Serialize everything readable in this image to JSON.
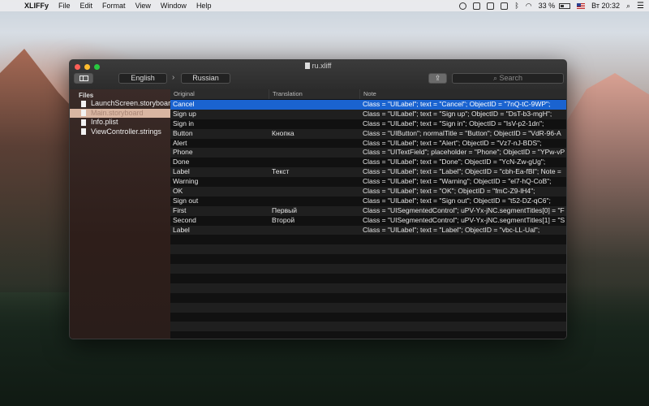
{
  "menubar": {
    "app_name": "XLIFFy",
    "menus": [
      "File",
      "Edit",
      "Format",
      "View",
      "Window",
      "Help"
    ],
    "battery": "33 %",
    "clock": "Вт 20:32"
  },
  "window": {
    "title": "ru.xliff",
    "source_language": "English",
    "target_language": "Russian",
    "search_placeholder": "Search"
  },
  "sidebar": {
    "header": "Files",
    "files": [
      {
        "name": "LaunchScreen.storyboard",
        "selected": false
      },
      {
        "name": "Main.storyboard",
        "selected": true
      },
      {
        "name": "Info.plist",
        "selected": false
      },
      {
        "name": "ViewController.strings",
        "selected": false
      }
    ]
  },
  "table": {
    "columns": [
      "Original",
      "Translation",
      "Note"
    ],
    "rows": [
      {
        "original": "Cancel",
        "translation": "",
        "note": "Class = \"UILabel\"; text = \"Cancel\"; ObjectID = \"7nQ-tC-9WP\";",
        "selected": true
      },
      {
        "original": "Sign up",
        "translation": "",
        "note": "Class = \"UILabel\"; text = \"Sign up\"; ObjectID = \"DsT-b3-mgH\";"
      },
      {
        "original": "Sign in",
        "translation": "",
        "note": "Class = \"UILabel\"; text = \"Sign in\"; ObjectID = \"IsV-p2-1dn\";"
      },
      {
        "original": "Button",
        "translation": "Кнопка",
        "note": "Class = \"UIButton\"; normalTitle = \"Button\"; ObjectID = \"VdR-96-A"
      },
      {
        "original": "Alert",
        "translation": "",
        "note": "Class = \"UILabel\"; text = \"Alert\"; ObjectID = \"Vz7-nJ-BDS\";"
      },
      {
        "original": "Phone",
        "translation": "",
        "note": "Class = \"UITextField\"; placeholder = \"Phone\"; ObjectID = \"YPw-vP"
      },
      {
        "original": "Done",
        "translation": "",
        "note": "Class = \"UILabel\"; text = \"Done\"; ObjectID = \"YcN-Zw-gUg\";"
      },
      {
        "original": "Label",
        "translation": "Текст",
        "note": "Class = \"UILabel\"; text = \"Label\"; ObjectID = \"cbh-Ea-fBI\"; Note ="
      },
      {
        "original": "Warning",
        "translation": "",
        "note": "Class = \"UILabel\"; text = \"Warning\"; ObjectID = \"el7-hQ-CoB\";"
      },
      {
        "original": "OK",
        "translation": "",
        "note": "Class = \"UILabel\"; text = \"OK\"; ObjectID = \"fmC-Z9-lH4\";"
      },
      {
        "original": "Sign out",
        "translation": "",
        "note": "Class = \"UILabel\"; text = \"Sign out\"; ObjectID = \"t52-DZ-qC6\";"
      },
      {
        "original": "First",
        "translation": "Первый",
        "note": "Class = \"UISegmentedControl\"; uPV-Yx-jNC.segmentTitles[0] = \"F"
      },
      {
        "original": "Second",
        "translation": "Второй",
        "note": "Class = \"UISegmentedControl\"; uPV-Yx-jNC.segmentTitles[1] = \"S"
      },
      {
        "original": "Label",
        "translation": "",
        "note": "Class = \"UILabel\"; text = \"Label\"; ObjectID = \"vbc-LL-Ual\";"
      }
    ]
  },
  "colors": {
    "selection": "#1a63d0",
    "sidebar_selection": "#d9b6a2"
  }
}
